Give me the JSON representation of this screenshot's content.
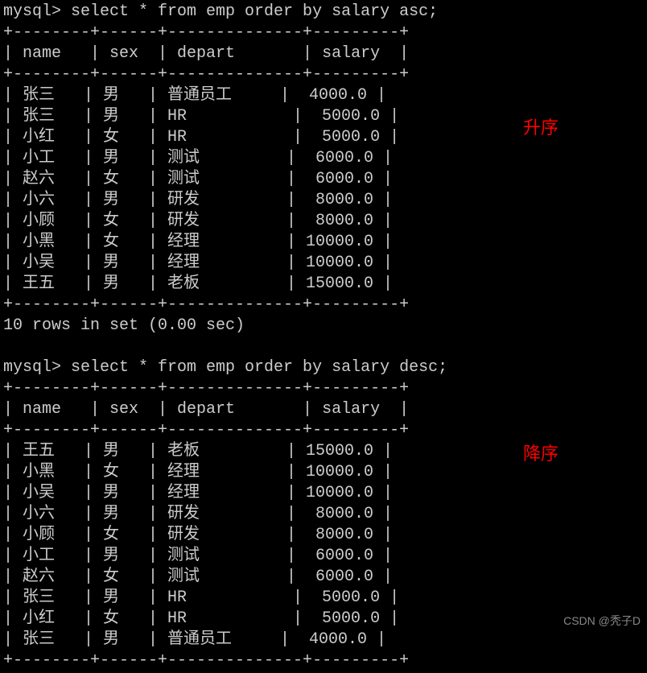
{
  "query1": {
    "prompt": "mysql> select * from emp order by salary asc;",
    "annotation": "升序",
    "headers": {
      "name": "name",
      "sex": "sex",
      "depart": "depart",
      "salary": "salary"
    },
    "rows": [
      {
        "name": "张三",
        "sex": "男",
        "depart": "普通员工",
        "salary": "4000.0"
      },
      {
        "name": "张三",
        "sex": "男",
        "depart": "HR",
        "salary": "5000.0"
      },
      {
        "name": "小红",
        "sex": "女",
        "depart": "HR",
        "salary": "5000.0"
      },
      {
        "name": "小工",
        "sex": "男",
        "depart": "测试",
        "salary": "6000.0"
      },
      {
        "name": "赵六",
        "sex": "女",
        "depart": "测试",
        "salary": "6000.0"
      },
      {
        "name": "小六",
        "sex": "男",
        "depart": "研发",
        "salary": "8000.0"
      },
      {
        "name": "小顾",
        "sex": "女",
        "depart": "研发",
        "salary": "8000.0"
      },
      {
        "name": "小黑",
        "sex": "女",
        "depart": "经理",
        "salary": "10000.0"
      },
      {
        "name": "小吴",
        "sex": "男",
        "depart": "经理",
        "salary": "10000.0"
      },
      {
        "name": "王五",
        "sex": "男",
        "depart": "老板",
        "salary": "15000.0"
      }
    ],
    "rowcount": "10 rows in set (0.00 sec)"
  },
  "query2": {
    "prompt": "mysql> select * from emp order by salary desc;",
    "annotation": "降序",
    "headers": {
      "name": "name",
      "sex": "sex",
      "depart": "depart",
      "salary": "salary"
    },
    "rows": [
      {
        "name": "王五",
        "sex": "男",
        "depart": "老板",
        "salary": "15000.0"
      },
      {
        "name": "小黑",
        "sex": "女",
        "depart": "经理",
        "salary": "10000.0"
      },
      {
        "name": "小吴",
        "sex": "男",
        "depart": "经理",
        "salary": "10000.0"
      },
      {
        "name": "小六",
        "sex": "男",
        "depart": "研发",
        "salary": "8000.0"
      },
      {
        "name": "小顾",
        "sex": "女",
        "depart": "研发",
        "salary": "8000.0"
      },
      {
        "name": "小工",
        "sex": "男",
        "depart": "测试",
        "salary": "6000.0"
      },
      {
        "name": "赵六",
        "sex": "女",
        "depart": "测试",
        "salary": "6000.0"
      },
      {
        "name": "张三",
        "sex": "男",
        "depart": "HR",
        "salary": "5000.0"
      },
      {
        "name": "小红",
        "sex": "女",
        "depart": "HR",
        "salary": "5000.0"
      },
      {
        "name": "张三",
        "sex": "男",
        "depart": "普通员工",
        "salary": "4000.0"
      }
    ]
  },
  "borders": {
    "line": "+--------+------+--------------+---------+"
  },
  "watermark": "CSDN @秃子D"
}
